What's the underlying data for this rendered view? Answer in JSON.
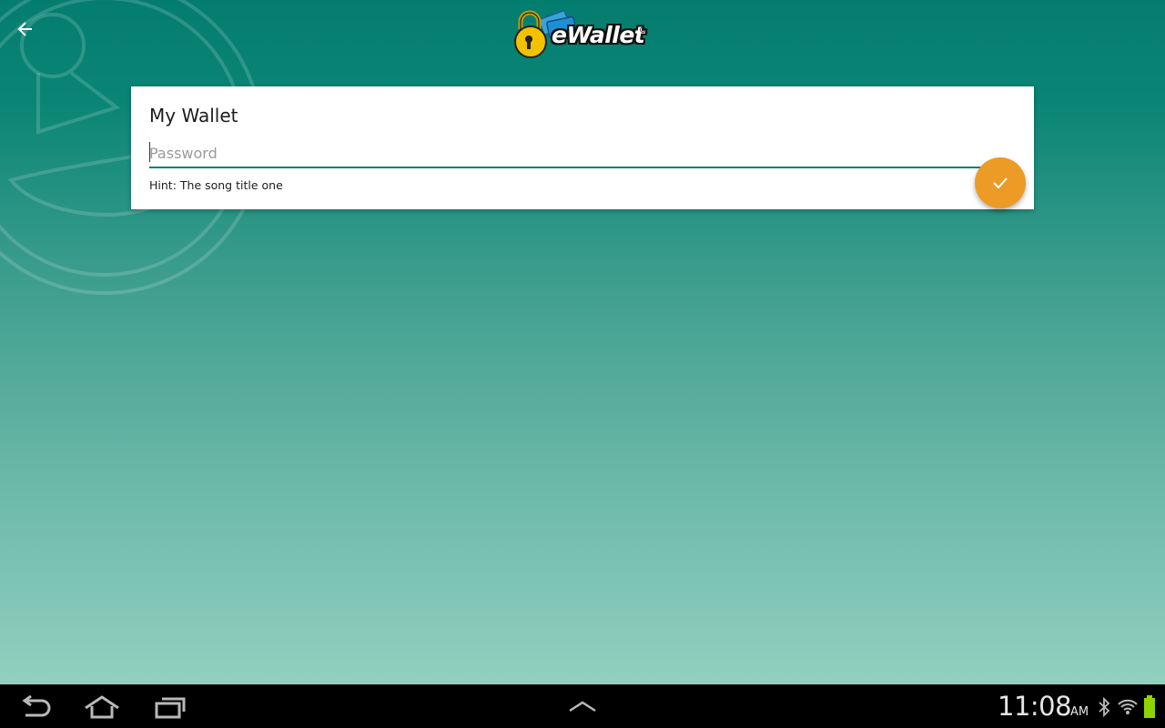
{
  "app": {
    "logo_text": "eWallet",
    "logo_mark": "®"
  },
  "toolbar": {
    "back_icon": "back-arrow-icon"
  },
  "unlock_card": {
    "wallet_name": "My Wallet",
    "password": {
      "placeholder": "Password",
      "value": ""
    },
    "hint": "Hint: The song title one",
    "confirm_icon": "checkmark-icon"
  },
  "system_bar": {
    "nav": [
      "back-icon",
      "home-icon",
      "recent-apps-icon",
      "show-more-icon"
    ],
    "time": "11:08",
    "ampm": "AM",
    "status_icons": [
      "bluetooth-icon",
      "wifi-icon",
      "battery-icon"
    ]
  },
  "colors": {
    "accent": "#ec9b27",
    "primary": "#0a7f70",
    "battery": "#8fd400"
  }
}
